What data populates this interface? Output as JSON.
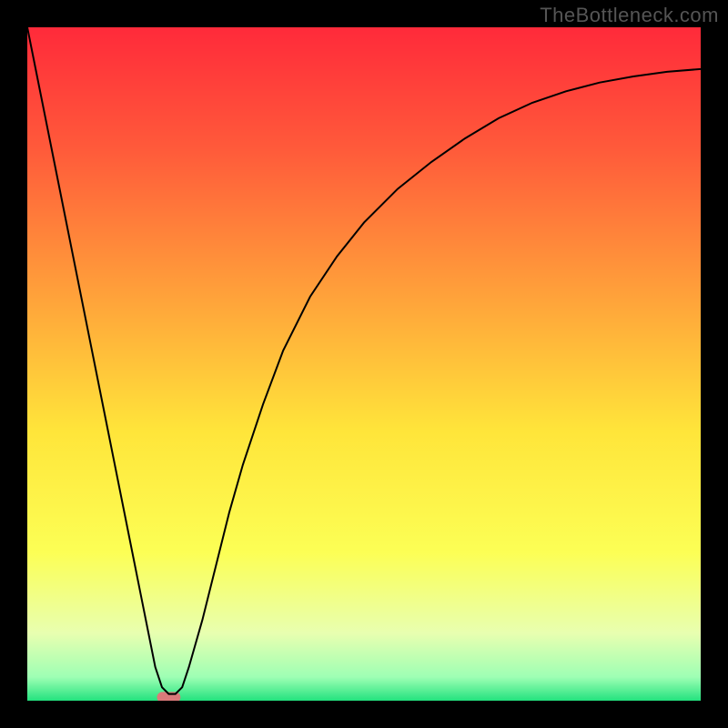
{
  "watermark": "TheBottleneck.com",
  "chart_data": {
    "type": "line",
    "title": "",
    "xlabel": "",
    "ylabel": "",
    "xlim": [
      0,
      100
    ],
    "ylim": [
      0,
      100
    ],
    "grid": false,
    "legend": false,
    "background_gradient": {
      "stops": [
        {
          "offset": 0.0,
          "color": "#ff2a3a"
        },
        {
          "offset": 0.18,
          "color": "#ff5a3a"
        },
        {
          "offset": 0.4,
          "color": "#ffa23a"
        },
        {
          "offset": 0.6,
          "color": "#ffe53a"
        },
        {
          "offset": 0.78,
          "color": "#fcff55"
        },
        {
          "offset": 0.9,
          "color": "#e8ffb0"
        },
        {
          "offset": 0.965,
          "color": "#9effb4"
        },
        {
          "offset": 1.0,
          "color": "#23e27e"
        }
      ]
    },
    "series": [
      {
        "name": "bottleneck-curve",
        "color": "#000000",
        "x": [
          0,
          2,
          4,
          6,
          8,
          10,
          12,
          14,
          16,
          18,
          19,
          20,
          21,
          22,
          23,
          24,
          26,
          28,
          30,
          32,
          35,
          38,
          42,
          46,
          50,
          55,
          60,
          65,
          70,
          75,
          80,
          85,
          90,
          95,
          100
        ],
        "y": [
          100,
          90,
          80,
          70,
          60,
          50,
          40,
          30,
          20,
          10,
          5,
          2,
          1,
          1,
          2,
          5,
          12,
          20,
          28,
          35,
          44,
          52,
          60,
          66,
          71,
          76,
          80,
          83.5,
          86.5,
          88.8,
          90.5,
          91.8,
          92.7,
          93.4,
          93.8
        ]
      }
    ],
    "marker": {
      "name": "optimal-point",
      "x": 21,
      "y": 0.5,
      "width": 3.5,
      "height": 1.6,
      "color": "#db7a7a"
    }
  }
}
